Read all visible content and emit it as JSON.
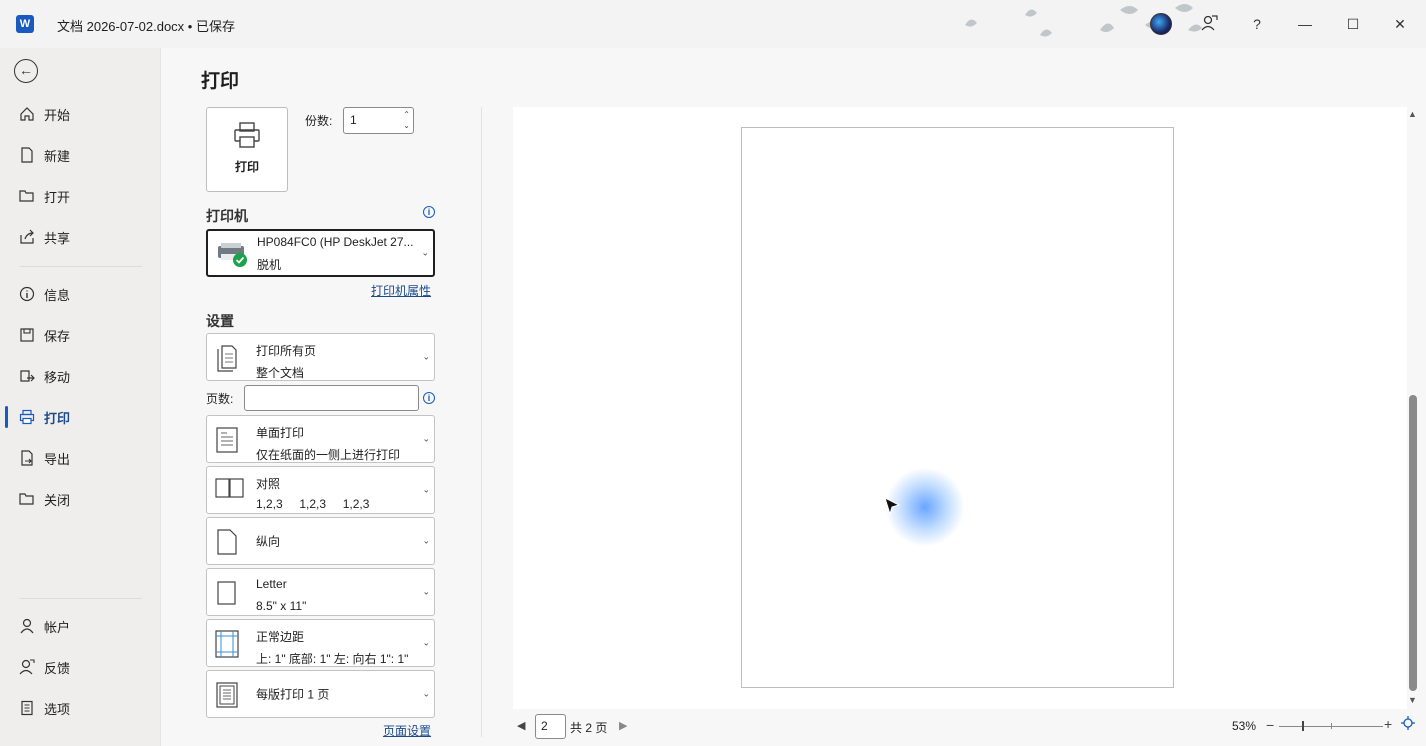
{
  "titlebar": {
    "app_icon_letter": "W",
    "doc_title": "文档 2026-07-02.docx • 已保存",
    "help": "?",
    "minimize": "—",
    "maximize": "☐",
    "close": "✕"
  },
  "nav": {
    "items": [
      {
        "label": "开始",
        "icon": "home-icon"
      },
      {
        "label": "新建",
        "icon": "new-doc-icon"
      },
      {
        "label": "打开",
        "icon": "folder-open-icon"
      },
      {
        "label": "共享",
        "icon": "share-icon"
      },
      {
        "label": "信息",
        "icon": "info-icon"
      },
      {
        "label": "保存",
        "icon": "save-icon"
      },
      {
        "label": "移动",
        "icon": "move-icon"
      },
      {
        "label": "打印",
        "icon": "printer-icon",
        "active": true
      },
      {
        "label": "导出",
        "icon": "export-icon"
      },
      {
        "label": "关闭",
        "icon": "close-folder-icon"
      },
      {
        "label": "帐户",
        "icon": "account-icon"
      },
      {
        "label": "反馈",
        "icon": "feedback-icon"
      },
      {
        "label": "选项",
        "icon": "options-icon"
      }
    ]
  },
  "print": {
    "page_title": "打印",
    "print_button_label": "打印",
    "copies_label": "份数:",
    "copies_value": "1",
    "printer_heading": "打印机",
    "printer_name": "HP084FC0 (HP DeskJet 27...",
    "printer_status": "脱机",
    "printer_properties_link": "打印机属性",
    "settings_heading": "设置",
    "pages_label": "页数:",
    "pages_value": "",
    "page_setup_link": "页面设置",
    "settings": [
      {
        "line1": "打印所有页",
        "line2": "整个文档",
        "icon": "pages-icon"
      },
      {
        "line1": "单面打印",
        "line2": "仅在纸面的一侧上进行打印",
        "icon": "one-sided-icon"
      },
      {
        "line1": "对照",
        "line2": "1,2,3     1,2,3     1,2,3",
        "icon": "collate-icon"
      },
      {
        "line1": "纵向",
        "line2": "",
        "icon": "portrait-icon"
      },
      {
        "line1": "Letter",
        "line2": "8.5\" x 11\"",
        "icon": "paper-size-icon"
      },
      {
        "line1": "正常边距",
        "line2": "上: 1\" 底部: 1\" 左: 向右 1\": 1\"",
        "icon": "margins-icon"
      },
      {
        "line1": "每版打印 1 页",
        "line2": "",
        "icon": "pages-per-sheet-icon"
      }
    ]
  },
  "preview": {
    "current_page": "2",
    "total_pages_text": "共 2 页",
    "zoom": "53%",
    "zoom_minus": "−",
    "zoom_plus": "+"
  },
  "colors": {
    "accent": "#185abd",
    "link": "#1a4a8a",
    "status_ok": "#1aa34a"
  }
}
